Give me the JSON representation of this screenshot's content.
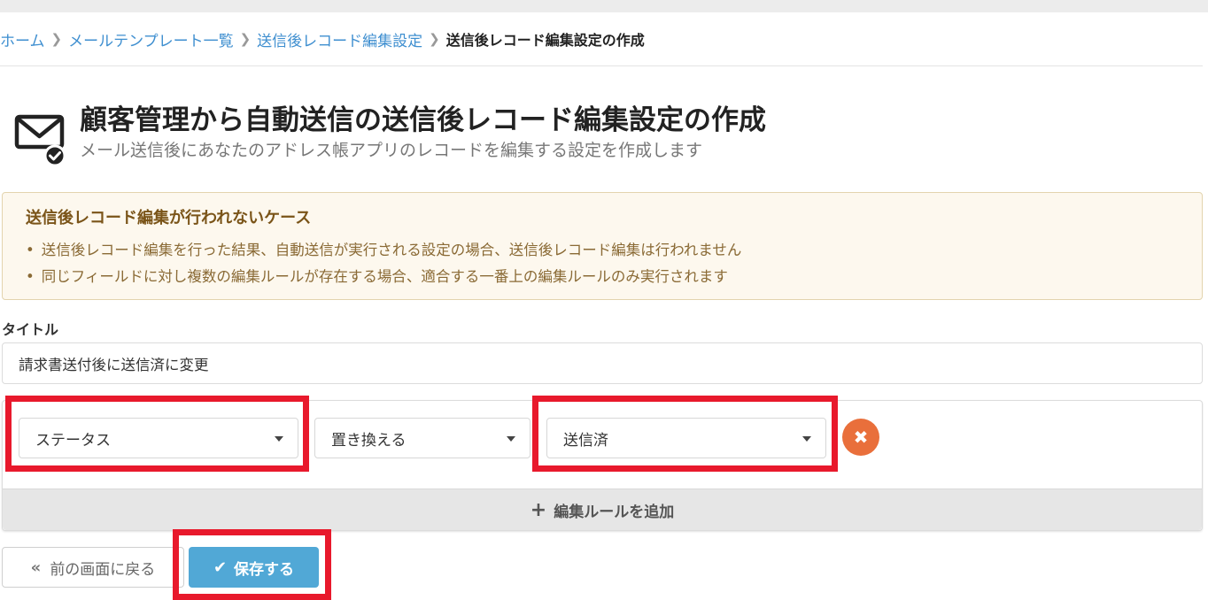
{
  "breadcrumb": {
    "items": [
      "ホーム",
      "メールテンプレート一覧",
      "送信後レコード編集設定"
    ],
    "current": "送信後レコード編集設定の作成"
  },
  "header": {
    "icon": "mail-check-icon",
    "title": "顧客管理から自動送信の送信後レコード編集設定の作成",
    "subtitle": "メール送信後にあなたのアドレス帳アプリのレコードを編集する設定を作成します"
  },
  "notice": {
    "title": "送信後レコード編集が行われないケース",
    "items": [
      "送信後レコード編集を行った結果、自動送信が実行される設定の場合、送信後レコード編集は行われません",
      "同じフィールドに対し複数の編集ルールが存在する場合、適合する一番上の編集ルールのみ実行されます"
    ]
  },
  "form": {
    "title_label": "タイトル",
    "title_value": "請求書送付後に送信済に変更"
  },
  "rules": [
    {
      "field": "ステータス",
      "operation": "置き換える",
      "value": "送信済"
    }
  ],
  "add_rule_label": "編集ルールを追加",
  "buttons": {
    "back": "前の画面に戻る",
    "save": "保存する"
  },
  "colors": {
    "link": "#3f8fd0",
    "primary": "#51a8d6",
    "danger": "#e96f3b",
    "highlight": "#e8192c",
    "notice_bg": "#fdf8ee"
  }
}
